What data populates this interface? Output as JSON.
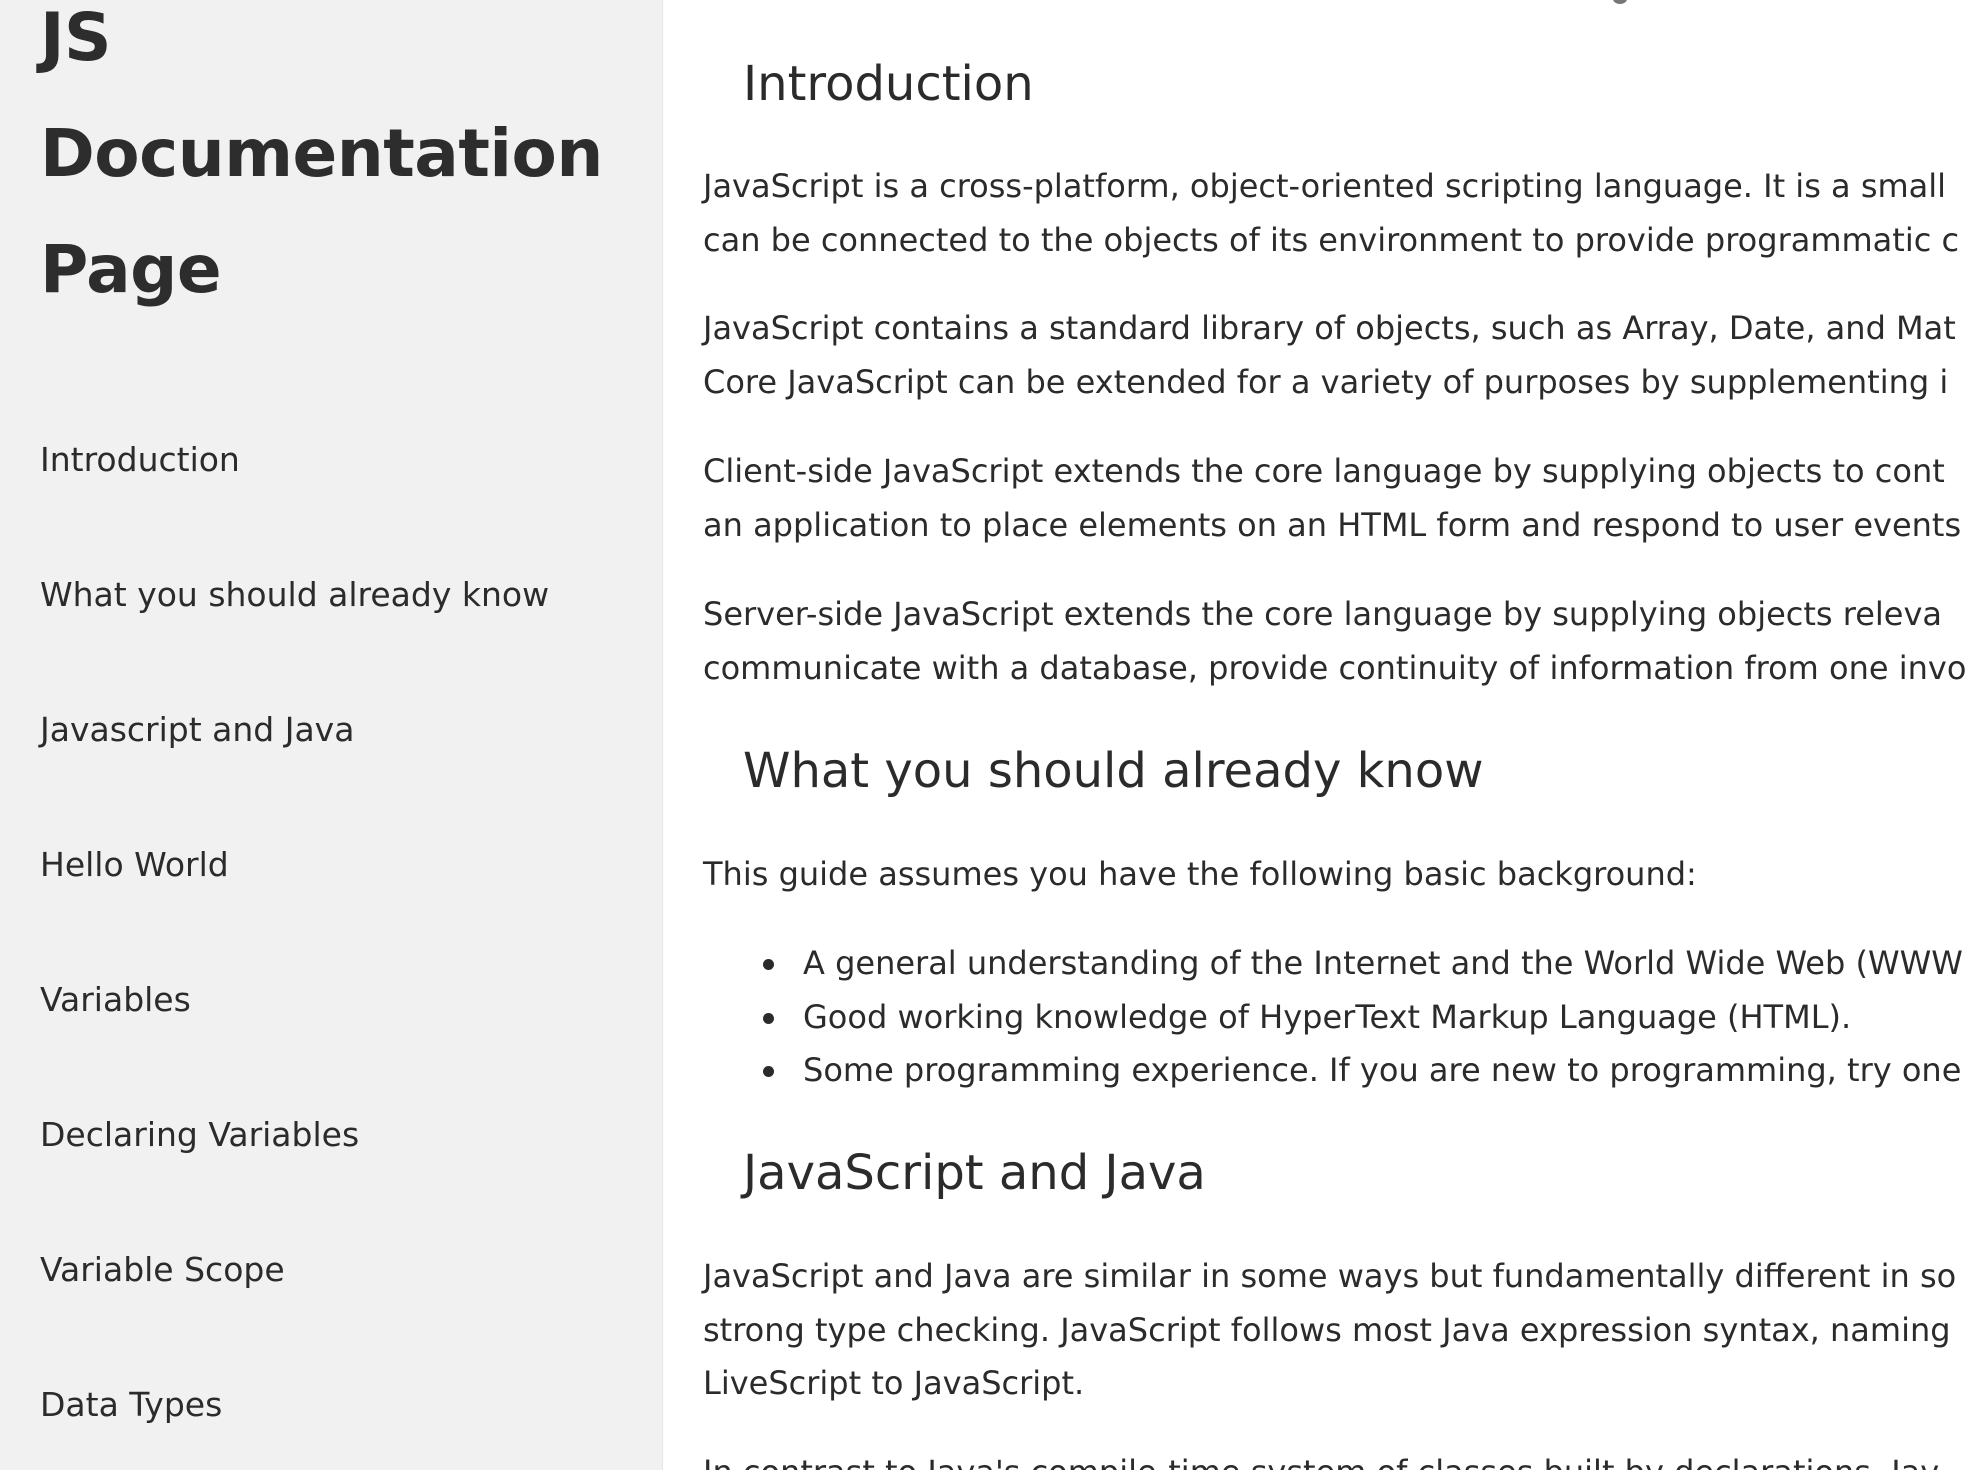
{
  "sidebar": {
    "title_lines": [
      "JS",
      "Documentation",
      "Page"
    ],
    "items": [
      {
        "label": "Introduction"
      },
      {
        "label": "What you should already know"
      },
      {
        "label": "Javascript and Java"
      },
      {
        "label": "Hello World"
      },
      {
        "label": "Variables"
      },
      {
        "label": "Declaring Variables"
      },
      {
        "label": "Variable Scope"
      },
      {
        "label": "Data Types"
      }
    ]
  },
  "main": {
    "sections": [
      {
        "heading": "Introduction",
        "paragraphs": [
          [
            "JavaScript is a cross-platform, object-oriented scripting language. It is a small",
            "can be connected to the objects of its environment to provide programmatic c"
          ],
          [
            "JavaScript contains a standard library of objects, such as Array, Date, and Mat",
            "Core JavaScript can be extended for a variety of purposes by supplementing i"
          ],
          [
            "Client-side JavaScript extends the core language by supplying objects to cont",
            "an application to place elements on an HTML form and respond to user events"
          ],
          [
            "Server-side JavaScript extends the core language by supplying objects releva",
            "communicate with a database, provide continuity of information from one invo"
          ]
        ]
      },
      {
        "heading": "What you should already know",
        "intro": "This guide assumes you have the following basic background:",
        "bullets": [
          "A general understanding of the Internet and the World Wide Web (WWW",
          "Good working knowledge of HyperText Markup Language (HTML).",
          "Some programming experience. If you are new to programming, try one"
        ]
      },
      {
        "heading": "JavaScript and Java",
        "paragraphs": [
          [
            "JavaScript and Java are similar in some ways but fundamentally different in so",
            "strong type checking. JavaScript follows most Java expression syntax, naming",
            "LiveScript to JavaScript."
          ],
          [
            "In contrast to Java's compile-time system of classes built by declarations, Jav"
          ]
        ]
      }
    ]
  }
}
